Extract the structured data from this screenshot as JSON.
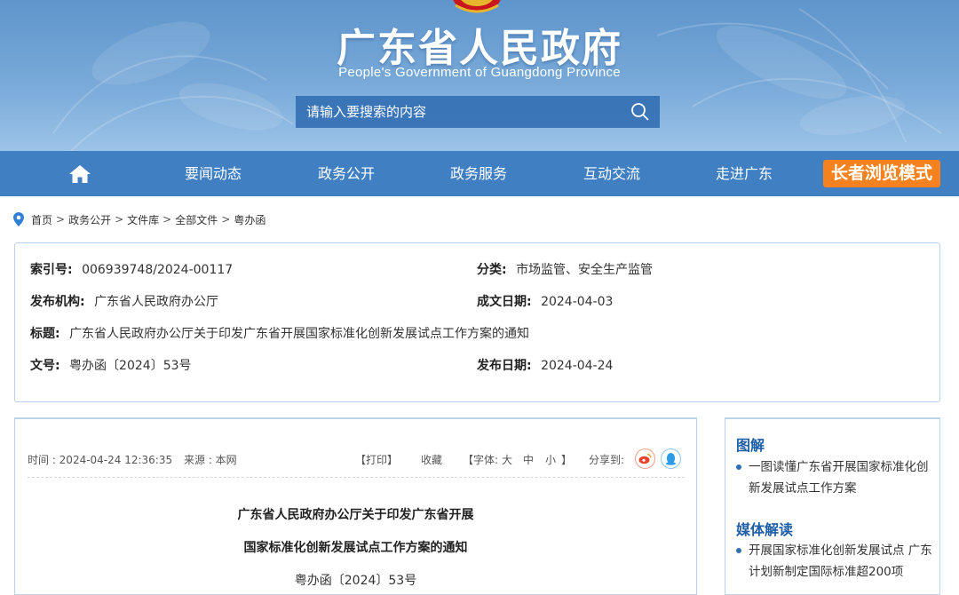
{
  "header": {
    "title": "广东省人民政府",
    "subtitle": "People's Government of Guangdong Province",
    "search_placeholder": "请输入要搜索的内容"
  },
  "nav": {
    "home_icon": "home-icon",
    "items": [
      {
        "label": "要闻动态"
      },
      {
        "label": "政务公开"
      },
      {
        "label": "政务服务"
      },
      {
        "label": "互动交流"
      },
      {
        "label": "走进广东"
      }
    ],
    "elder_mode": "长者浏览模式"
  },
  "breadcrumb": [
    "首页",
    "政务公开",
    "文件库",
    "全部文件",
    "粤办函"
  ],
  "meta": {
    "index_no_label": "索引号:",
    "index_no": "006939748/2024-00117",
    "category_label": "分类:",
    "category": "市场监管、安全生产监管",
    "issuer_label": "发布机构:",
    "issuer": "广东省人民政府办公厅",
    "written_date_label": "成文日期:",
    "written_date": "2024-04-03",
    "title_label": "标题:",
    "title": "广东省人民政府办公厅关于印发广东省开展国家标准化创新发展试点工作方案的通知",
    "doc_no_label": "文号:",
    "doc_no": "粤办函〔2024〕53号",
    "publish_date_label": "发布日期:",
    "publish_date": "2024-04-24"
  },
  "article": {
    "time": "时间 : 2024-04-24 12:36:35",
    "source": "来源 : 本网",
    "print": "【打印】",
    "favorite": "收藏",
    "font_label": "【字体:",
    "font_large": "大",
    "font_medium": "中",
    "font_small": "小",
    "font_close": "】",
    "share_label": "分享到:",
    "title_line1": "广东省人民政府办公厅关于印发广东省开展",
    "title_line2": "国家标准化创新发展试点工作方案的通知",
    "doc_no": "粤办函〔2024〕53号"
  },
  "sidebar": {
    "section1_title": "图解",
    "section1_items": [
      "一图读懂广东省开展国家标准化创新发展试点工作方案"
    ],
    "section2_title": "媒体解读",
    "section2_items": [
      "开展国家标准化创新发展试点 广东计划新制定国际标准超200项"
    ]
  },
  "colors": {
    "nav_bg": "#3f7fc2",
    "elder_bg": "#f5821f",
    "border": "#b9d3ea",
    "accent": "#1f5fa6"
  }
}
